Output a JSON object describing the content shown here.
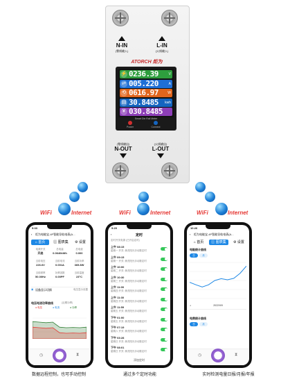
{
  "device": {
    "n_in_label": "N-IN",
    "n_in_sub": "(零线输入)",
    "l_in_label": "L-IN",
    "l_in_sub": "(火线输入)",
    "brand": "ATORCH 炬为",
    "readings": [
      {
        "icon": "⚡",
        "value": "0236.39",
        "unit": "V",
        "color": "#2e9e3e"
      },
      {
        "icon": "⇄",
        "value": "005.220",
        "unit": "A",
        "color": "#1f6fd6"
      },
      {
        "icon": "⟲",
        "value": "0616.97",
        "unit": "W",
        "color": "#e0651d"
      },
      {
        "icon": "▤",
        "value": "30.8485",
        "unit": "kwh",
        "color": "#1565c0"
      },
      {
        "icon": "¥",
        "value": "030.8485",
        "unit": "",
        "color": "#8e3fb8"
      }
    ],
    "model": "Smart Din Rail Meter",
    "power_label": "Power",
    "connect_label": "Connect",
    "n_out_sub": "(零线输出)",
    "n_out_label": "N-OUT",
    "l_out_sub": "(火线输出)",
    "l_out_label": "L-OUT"
  },
  "wifi": {
    "wifi": "WiFi",
    "internet": "Internet"
  },
  "phone1": {
    "time": "9:33",
    "title": "炬为电能宝-4P智能导轨电表(A...",
    "tabs": [
      "首页",
      "图表集",
      "设置"
    ],
    "cells": [
      {
        "label": "电源开关",
        "value": "开启"
      },
      {
        "label": "总电量",
        "value": "0.0640kWh"
      },
      {
        "label": "总电费",
        "value": "0.000"
      },
      {
        "label": "当前电压",
        "value": "226.6V"
      },
      {
        "label": "当前电流",
        "value": "0.001A"
      },
      {
        "label": "当前功率",
        "value": "369.8W"
      },
      {
        "label": "当前频率",
        "value": "50.00Hz"
      },
      {
        "label": "功率因数",
        "value": "0.00PF"
      },
      {
        "label": "当前温度",
        "value": "23°C"
      }
    ],
    "list_item": "设备显示切换",
    "list_item_right": "电压显示设置",
    "chart_title": "电压电流功率曲线",
    "chart_sub": "(近期功率)",
    "legend": [
      "● 电压",
      "● 电流",
      "● 功率"
    ],
    "red_line": [
      0.42,
      0.4,
      0.38,
      0.4,
      0.22,
      0.2,
      0.21,
      0.2,
      0.22
    ],
    "green_line": [
      0.62,
      0.6,
      0.58,
      0.6,
      0.42,
      0.4,
      0.41,
      0.4,
      0.42
    ],
    "nav": [
      "clock-icon",
      "power-icon",
      "hourglass-icon"
    ]
  },
  "phone2": {
    "time": "9:20",
    "title": "定时",
    "sub": "定时开关电源 (已开启定时)",
    "items": [
      {
        "time": "上午 08:15",
        "desc": "星期一  开关: 美洗阳光手动数定时"
      },
      {
        "time": "上午 09:15",
        "desc": "星期一  开关: 美洗阳光手动数定时"
      },
      {
        "time": "上午 10:00",
        "desc": "星期二  开关: 美洗阳光手动数定时"
      },
      {
        "time": "上午 10:30",
        "desc": "星期三  开关: 美洗阳光手动数定时"
      },
      {
        "time": "上午 11:00",
        "desc": "星期四  开关: 美洗阳光手动数定时"
      },
      {
        "time": "上午 11:30",
        "desc": "星期四  开关: 美洗阳光手动数定时"
      },
      {
        "time": "上午 11:59",
        "desc": "星期五  开关: 美洗阳光手动数定时"
      },
      {
        "time": "下午 01:00",
        "desc": "星期五  开关: 美洗阳光手动数定时"
      },
      {
        "time": "下午 07:19",
        "desc": "星期六  开关: 美洗阳光手动数定时"
      },
      {
        "time": "下午 03:28",
        "desc": "星期日  开关: 美洗阳光手动数定时"
      },
      {
        "time": "下午 08:01",
        "desc": "星期日  开关: 美洗阳光手动数定时"
      }
    ],
    "add_label": "添加定时"
  },
  "phone3": {
    "time": "10:26",
    "title": "炬为电能宝-4P智能导轨电表(A...",
    "tabs": [
      "首页",
      "图表集",
      "设置"
    ],
    "chart1_title": "电能统计曲线",
    "chip_active": "日",
    "chip_other": "月",
    "curve": [
      0.55,
      0.62,
      0.68,
      0.62,
      0.5,
      0.45,
      0.48,
      0.44,
      0.3,
      0.1
    ],
    "date_label": "2022/9/9",
    "chart2_title": "电费统计曲线",
    "chip2_active": "日",
    "chip2_other": "月",
    "nav": [
      "clock-icon",
      "power-icon",
      "hourglass-icon"
    ]
  },
  "captions": [
    "数据远程控制，也可手动控制",
    "通过多个定时功能",
    "实时检测电量日报/月报/年报"
  ]
}
